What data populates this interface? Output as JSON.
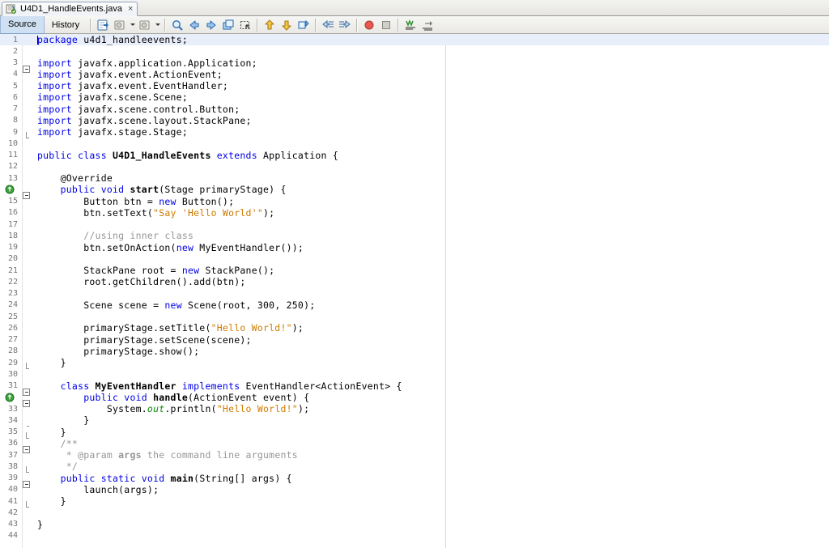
{
  "window": {
    "tab": {
      "label": "U4D1_HandleEvents.java",
      "close": "×",
      "icon": "java-file-icon"
    }
  },
  "toolbar": {
    "view_tabs": [
      {
        "label": "Source",
        "selected": true
      },
      {
        "label": "History",
        "selected": false
      }
    ],
    "buttons": [
      {
        "name": "last-edit-icon"
      },
      {
        "name": "back-dropdown-icon"
      },
      {
        "name": "forward-dropdown-icon"
      },
      {
        "name": "find-selection-icon"
      },
      {
        "name": "find-previous-icon"
      },
      {
        "name": "find-next-icon"
      },
      {
        "name": "toggle-rectangular-selection-icon"
      },
      {
        "name": "toggle-highlight-search-icon"
      },
      {
        "name": "previous-bookmark-icon"
      },
      {
        "name": "next-bookmark-icon"
      },
      {
        "name": "toggle-bookmark-icon"
      },
      {
        "name": "shift-left-icon"
      },
      {
        "name": "shift-right-icon"
      },
      {
        "name": "start-macro-recording-icon"
      },
      {
        "name": "stop-macro-recording-icon"
      },
      {
        "name": "comment-icon"
      },
      {
        "name": "uncomment-icon"
      }
    ]
  },
  "editor": {
    "margin_column_x": 550,
    "current_line": 1,
    "colors": {
      "keyword": "#0000e6",
      "string": "#ce7b00",
      "comment": "#969696",
      "static_field": "#0f8a0f",
      "current_line_bg": "#e9eefb",
      "margin_line": "#ffc8c8"
    },
    "lines": [
      {
        "n": "1",
        "annot": "",
        "fold": "",
        "current": true,
        "tokens": [
          {
            "t": "caret",
            "v": ""
          },
          {
            "t": "kw",
            "v": "package"
          },
          {
            "t": "pln",
            "v": " u4d1_handleevents;"
          }
        ]
      },
      {
        "n": "2",
        "annot": "",
        "fold": "",
        "tokens": []
      },
      {
        "n": "3",
        "annot": "",
        "fold": "box",
        "tokens": [
          {
            "t": "kw",
            "v": "import"
          },
          {
            "t": "pln",
            "v": " javafx.application.Application;"
          }
        ]
      },
      {
        "n": "4",
        "annot": "",
        "fold": "stem",
        "tokens": [
          {
            "t": "kw",
            "v": "import"
          },
          {
            "t": "pln",
            "v": " javafx.event.ActionEvent;"
          }
        ]
      },
      {
        "n": "5",
        "annot": "",
        "fold": "stem",
        "tokens": [
          {
            "t": "kw",
            "v": "import"
          },
          {
            "t": "pln",
            "v": " javafx.event.EventHandler;"
          }
        ]
      },
      {
        "n": "6",
        "annot": "",
        "fold": "stem",
        "tokens": [
          {
            "t": "kw",
            "v": "import"
          },
          {
            "t": "pln",
            "v": " javafx.scene.Scene;"
          }
        ]
      },
      {
        "n": "7",
        "annot": "",
        "fold": "stem",
        "tokens": [
          {
            "t": "kw",
            "v": "import"
          },
          {
            "t": "pln",
            "v": " javafx.scene.control.Button;"
          }
        ]
      },
      {
        "n": "8",
        "annot": "",
        "fold": "stem",
        "tokens": [
          {
            "t": "kw",
            "v": "import"
          },
          {
            "t": "pln",
            "v": " javafx.scene.layout.StackPane;"
          }
        ]
      },
      {
        "n": "9",
        "annot": "",
        "fold": "end",
        "tokens": [
          {
            "t": "kw",
            "v": "import"
          },
          {
            "t": "pln",
            "v": " javafx.stage.Stage;"
          }
        ]
      },
      {
        "n": "10",
        "annot": "",
        "fold": "",
        "tokens": []
      },
      {
        "n": "11",
        "annot": "",
        "fold": "",
        "tokens": [
          {
            "t": "kw",
            "v": "public class "
          },
          {
            "t": "bld",
            "v": "U4D1_HandleEvents"
          },
          {
            "t": "kw",
            "v": " extends "
          },
          {
            "t": "pln",
            "v": "Application {"
          }
        ]
      },
      {
        "n": "12",
        "annot": "",
        "fold": "",
        "tokens": []
      },
      {
        "n": "13",
        "annot": "",
        "fold": "",
        "tokens": [
          {
            "t": "pln",
            "v": "    @Override"
          }
        ]
      },
      {
        "n": "14",
        "annot": "override",
        "fold": "box",
        "tokens": [
          {
            "t": "pln",
            "v": "    "
          },
          {
            "t": "kw",
            "v": "public void "
          },
          {
            "t": "bld",
            "v": "start"
          },
          {
            "t": "pln",
            "v": "(Stage primaryStage) {"
          }
        ]
      },
      {
        "n": "15",
        "annot": "",
        "fold": "stem",
        "tokens": [
          {
            "t": "pln",
            "v": "        Button btn = "
          },
          {
            "t": "kw",
            "v": "new"
          },
          {
            "t": "pln",
            "v": " Button();"
          }
        ]
      },
      {
        "n": "16",
        "annot": "",
        "fold": "stem",
        "tokens": [
          {
            "t": "pln",
            "v": "        btn.setText("
          },
          {
            "t": "str",
            "v": "\"Say 'Hello World'\""
          },
          {
            "t": "pln",
            "v": ");"
          }
        ]
      },
      {
        "n": "17",
        "annot": "",
        "fold": "stem",
        "tokens": []
      },
      {
        "n": "18",
        "annot": "",
        "fold": "stem",
        "tokens": [
          {
            "t": "pln",
            "v": "        "
          },
          {
            "t": "cmt",
            "v": "//using inner class"
          }
        ]
      },
      {
        "n": "19",
        "annot": "",
        "fold": "stem",
        "tokens": [
          {
            "t": "pln",
            "v": "        btn.setOnAction("
          },
          {
            "t": "kw",
            "v": "new"
          },
          {
            "t": "pln",
            "v": " MyEventHandler());"
          }
        ]
      },
      {
        "n": "20",
        "annot": "",
        "fold": "stem",
        "tokens": []
      },
      {
        "n": "21",
        "annot": "",
        "fold": "stem",
        "tokens": [
          {
            "t": "pln",
            "v": "        StackPane root = "
          },
          {
            "t": "kw",
            "v": "new"
          },
          {
            "t": "pln",
            "v": " StackPane();"
          }
        ]
      },
      {
        "n": "22",
        "annot": "",
        "fold": "stem",
        "tokens": [
          {
            "t": "pln",
            "v": "        root.getChildren().add(btn);"
          }
        ]
      },
      {
        "n": "23",
        "annot": "",
        "fold": "stem",
        "tokens": []
      },
      {
        "n": "24",
        "annot": "",
        "fold": "stem",
        "tokens": [
          {
            "t": "pln",
            "v": "        Scene scene = "
          },
          {
            "t": "kw",
            "v": "new"
          },
          {
            "t": "pln",
            "v": " Scene(root, 300, 250);"
          }
        ]
      },
      {
        "n": "25",
        "annot": "",
        "fold": "stem",
        "tokens": []
      },
      {
        "n": "26",
        "annot": "",
        "fold": "stem",
        "tokens": [
          {
            "t": "pln",
            "v": "        primaryStage.setTitle("
          },
          {
            "t": "str",
            "v": "\"Hello World!\""
          },
          {
            "t": "pln",
            "v": ");"
          }
        ]
      },
      {
        "n": "27",
        "annot": "",
        "fold": "stem",
        "tokens": [
          {
            "t": "pln",
            "v": "        primaryStage.setScene(scene);"
          }
        ]
      },
      {
        "n": "28",
        "annot": "",
        "fold": "stem",
        "tokens": [
          {
            "t": "pln",
            "v": "        primaryStage.show();"
          }
        ]
      },
      {
        "n": "29",
        "annot": "",
        "fold": "end",
        "tokens": [
          {
            "t": "pln",
            "v": "    }"
          }
        ]
      },
      {
        "n": "30",
        "annot": "",
        "fold": "",
        "tokens": []
      },
      {
        "n": "31",
        "annot": "",
        "fold": "box",
        "tokens": [
          {
            "t": "kw",
            "v": "    class "
          },
          {
            "t": "bld",
            "v": "MyEventHandler"
          },
          {
            "t": "kw",
            "v": " implements "
          },
          {
            "t": "pln",
            "v": "EventHandler<ActionEvent> {"
          }
        ]
      },
      {
        "n": "32",
        "annot": "override",
        "fold": "box",
        "tokens": [
          {
            "t": "pln",
            "v": "        "
          },
          {
            "t": "kw",
            "v": "public void "
          },
          {
            "t": "bld",
            "v": "handle"
          },
          {
            "t": "pln",
            "v": "(ActionEvent event) {"
          }
        ]
      },
      {
        "n": "33",
        "annot": "",
        "fold": "stem",
        "tokens": [
          {
            "t": "pln",
            "v": "            System."
          },
          {
            "t": "fld",
            "v": "out"
          },
          {
            "t": "pln",
            "v": ".println("
          },
          {
            "t": "str",
            "v": "\"Hello World!\""
          },
          {
            "t": "pln",
            "v": ");"
          }
        ]
      },
      {
        "n": "34",
        "annot": "",
        "fold": "tick",
        "tokens": [
          {
            "t": "pln",
            "v": "        }"
          }
        ]
      },
      {
        "n": "35",
        "annot": "",
        "fold": "end",
        "tokens": [
          {
            "t": "pln",
            "v": "    }"
          }
        ]
      },
      {
        "n": "36",
        "annot": "",
        "fold": "box",
        "tokens": [
          {
            "t": "cmt",
            "v": "    /**"
          }
        ]
      },
      {
        "n": "37",
        "annot": "",
        "fold": "stem",
        "tokens": [
          {
            "t": "cmt",
            "v": "     * @param "
          },
          {
            "t": "cmtb",
            "v": "args"
          },
          {
            "t": "cmt",
            "v": " the command line arguments"
          }
        ]
      },
      {
        "n": "38",
        "annot": "",
        "fold": "end",
        "tokens": [
          {
            "t": "cmt",
            "v": "     */"
          }
        ]
      },
      {
        "n": "39",
        "annot": "",
        "fold": "box",
        "tokens": [
          {
            "t": "kw",
            "v": "    public static void "
          },
          {
            "t": "bld",
            "v": "main"
          },
          {
            "t": "pln",
            "v": "(String[] args) {"
          }
        ]
      },
      {
        "n": "40",
        "annot": "",
        "fold": "stem",
        "tokens": [
          {
            "t": "pln",
            "v": "        launch(args);"
          }
        ]
      },
      {
        "n": "41",
        "annot": "",
        "fold": "end",
        "tokens": [
          {
            "t": "pln",
            "v": "    }"
          }
        ]
      },
      {
        "n": "42",
        "annot": "",
        "fold": "",
        "tokens": []
      },
      {
        "n": "43",
        "annot": "",
        "fold": "",
        "tokens": [
          {
            "t": "pln",
            "v": "}"
          }
        ]
      },
      {
        "n": "44",
        "annot": "",
        "fold": "",
        "tokens": []
      }
    ]
  }
}
